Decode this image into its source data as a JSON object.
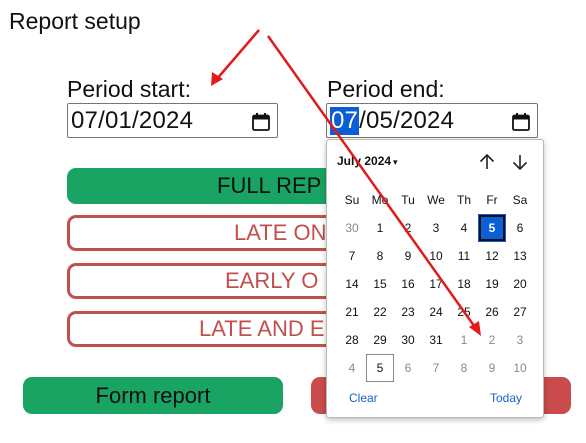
{
  "page": {
    "title": "Report setup"
  },
  "period_start": {
    "label": "Period start:",
    "value": "07/01/2024"
  },
  "period_end": {
    "label": "Period end:",
    "month_segment": "07",
    "rest": "/05/2024"
  },
  "buttons": {
    "full_report": "FULL REP",
    "late_only": "LATE ON",
    "early_only": "EARLY O",
    "late_and_early": "LATE AND E",
    "form_report": "Form report"
  },
  "calendar": {
    "month_label": "July 2024",
    "caret": "▾",
    "weekdays": [
      "Su",
      "Mo",
      "Tu",
      "We",
      "Th",
      "Fr",
      "Sa"
    ],
    "weeks": [
      [
        "30",
        "1",
        "2",
        "3",
        "4",
        "5",
        "6"
      ],
      [
        "7",
        "8",
        "9",
        "10",
        "11",
        "12",
        "13"
      ],
      [
        "14",
        "15",
        "16",
        "17",
        "18",
        "19",
        "20"
      ],
      [
        "21",
        "22",
        "23",
        "24",
        "25",
        "26",
        "27"
      ],
      [
        "28",
        "29",
        "30",
        "31",
        "1",
        "2",
        "3"
      ],
      [
        "4",
        "5",
        "6",
        "7",
        "8",
        "9",
        "10"
      ]
    ],
    "other_month": [
      [
        0,
        0
      ],
      [
        4,
        4
      ],
      [
        4,
        5
      ],
      [
        4,
        6
      ],
      [
        5,
        0
      ],
      [
        5,
        2
      ],
      [
        5,
        3
      ],
      [
        5,
        4
      ],
      [
        5,
        5
      ],
      [
        5,
        6
      ]
    ],
    "selected": [
      0,
      5
    ],
    "today": [
      5,
      1
    ],
    "clear_label": "Clear",
    "today_label": "Today"
  },
  "colors": {
    "green": "#19a463",
    "red": "#c0504d",
    "selection_blue": "#0b5fd6",
    "annotation_arrow": "#e01b1b"
  },
  "icons": {
    "calendar": "calendar-icon",
    "up": "arrow-up-icon",
    "down": "arrow-down-icon"
  }
}
